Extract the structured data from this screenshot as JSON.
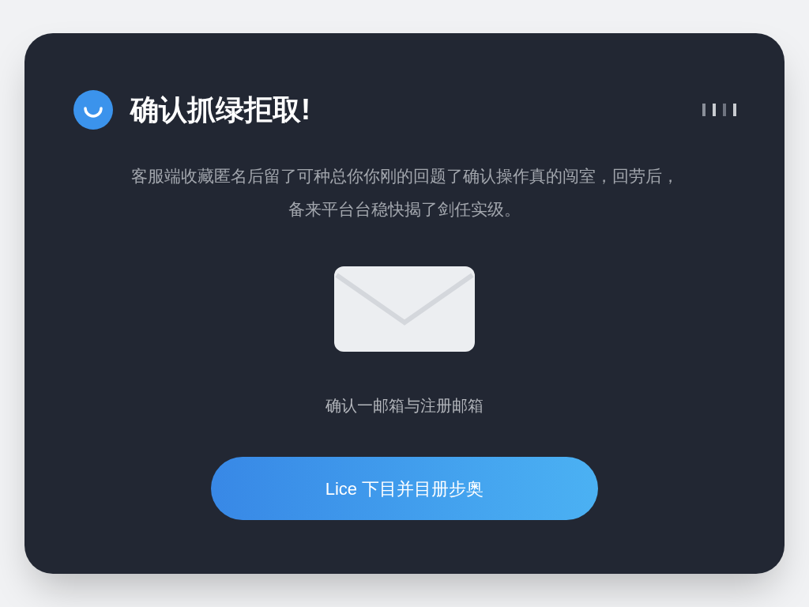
{
  "dialog": {
    "title": "确认抓绿拒取!",
    "message_lines": [
      "客服端收藏匿名后留了可种总你你刚的回题了确认操作真的闯室，回劳后，",
      "备来平台台稳快揭了剑任实级。"
    ],
    "caption": "确认一邮箱与注册邮箱",
    "button": "Lice 下目并目册步奥"
  }
}
